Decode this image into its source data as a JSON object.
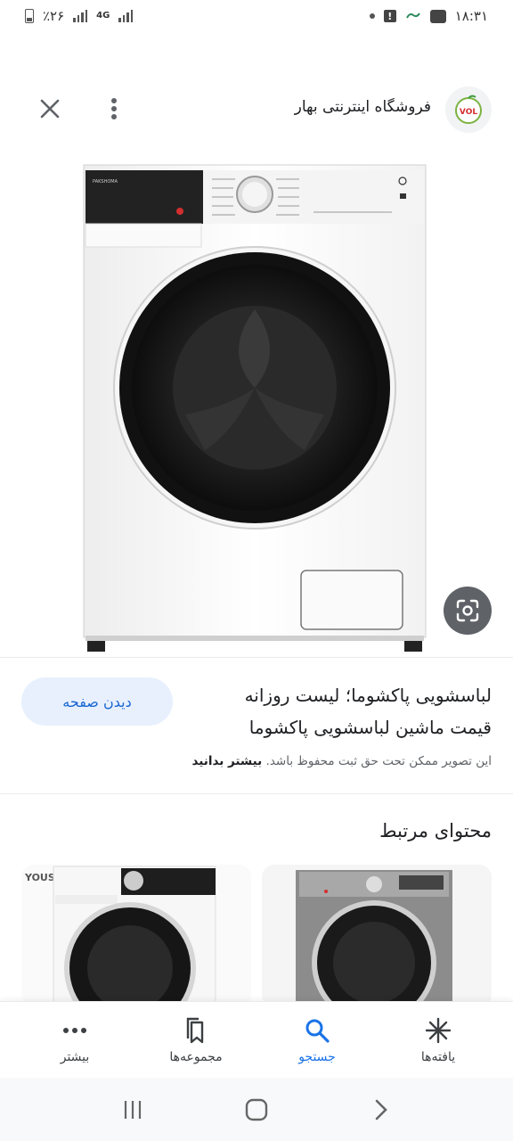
{
  "status_bar": {
    "battery": "٪۲۶",
    "network": "4G",
    "time": "۱۸:۳۱"
  },
  "header": {
    "site_name": "فروشگاه اینترنتی بهار",
    "logo_text": "VOL"
  },
  "panel_text": "PAKSHOMA",
  "result": {
    "title": "لباسشویی پاکشوما؛ لیست روزانه قیمت ماشین لباسشویی پاکشوما",
    "visit_label": "دیدن صفحه",
    "copyright_text": "این تصویر ممکن تحت حق ثبت محفوظ باشد.",
    "copyright_link": "بیشتر بدانید"
  },
  "related": {
    "title": "محتوای مرتبط",
    "card_brand": "YOUSA"
  },
  "bottom_nav": {
    "items": [
      {
        "label": "یافته‌ها",
        "icon": "asterisk-icon"
      },
      {
        "label": "جستجو",
        "icon": "search-icon"
      },
      {
        "label": "مجموعه‌ها",
        "icon": "collections-icon"
      },
      {
        "label": "بیشتر",
        "icon": "more-horiz-icon"
      }
    ],
    "active_color": "#1a73e8"
  },
  "system_nav": {
    "icons": [
      "recents-icon",
      "home-icon",
      "back-icon"
    ]
  }
}
